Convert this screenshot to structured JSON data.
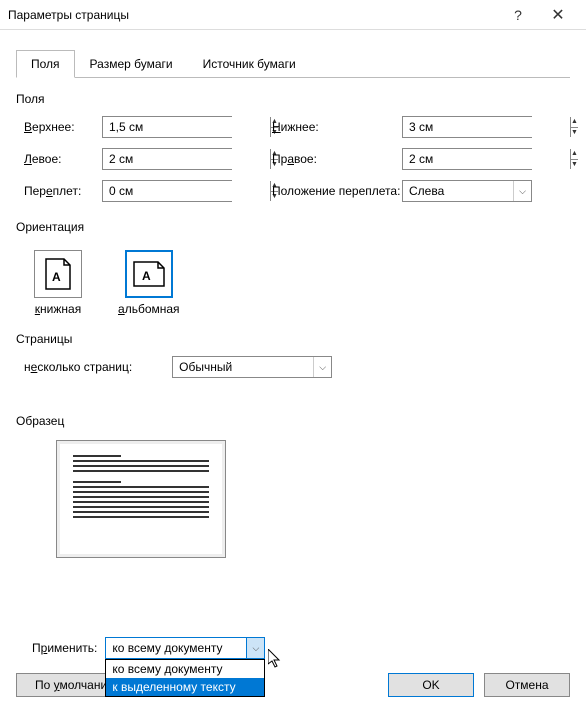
{
  "window": {
    "title": "Параметры страницы"
  },
  "tabs": {
    "fields": "Поля",
    "paper": "Размер бумаги",
    "source": "Источник бумаги"
  },
  "section": {
    "fields": "Поля",
    "orientation": "Ориентация",
    "pages": "Страницы",
    "preview": "Образец"
  },
  "margins": {
    "top_label": "Верхнее:",
    "top_key": "В",
    "top_value": "1,5 см",
    "bottom_label": "Нижнее:",
    "bottom_key": "Н",
    "bottom_value": "3 см",
    "left_label": "Левое:",
    "left_key": "Л",
    "left_value": "2 см",
    "right_label": "Правое:",
    "right_key": "П",
    "right_value": "2 см",
    "gutter_label": "Переплет:",
    "gutter_key": "ер",
    "gutter_value": "0 см",
    "gutter_pos_label": "Положение переплета:",
    "gutter_pos_value": "Слева"
  },
  "orientation": {
    "portrait": "книжная",
    "portrait_key": "к",
    "landscape": "альбомная",
    "landscape_key": "а"
  },
  "pages": {
    "multi_label": "несколько страниц:",
    "multi_key": "е",
    "multi_value": "Обычный"
  },
  "apply": {
    "label": "Применить:",
    "label_key": "р",
    "value": "ко всему документу",
    "options": [
      "ко всему документу",
      "к выделенному тексту"
    ]
  },
  "buttons": {
    "default": "По умолчанию...",
    "default_key": "у",
    "ok": "OK",
    "cancel": "Отмена"
  }
}
